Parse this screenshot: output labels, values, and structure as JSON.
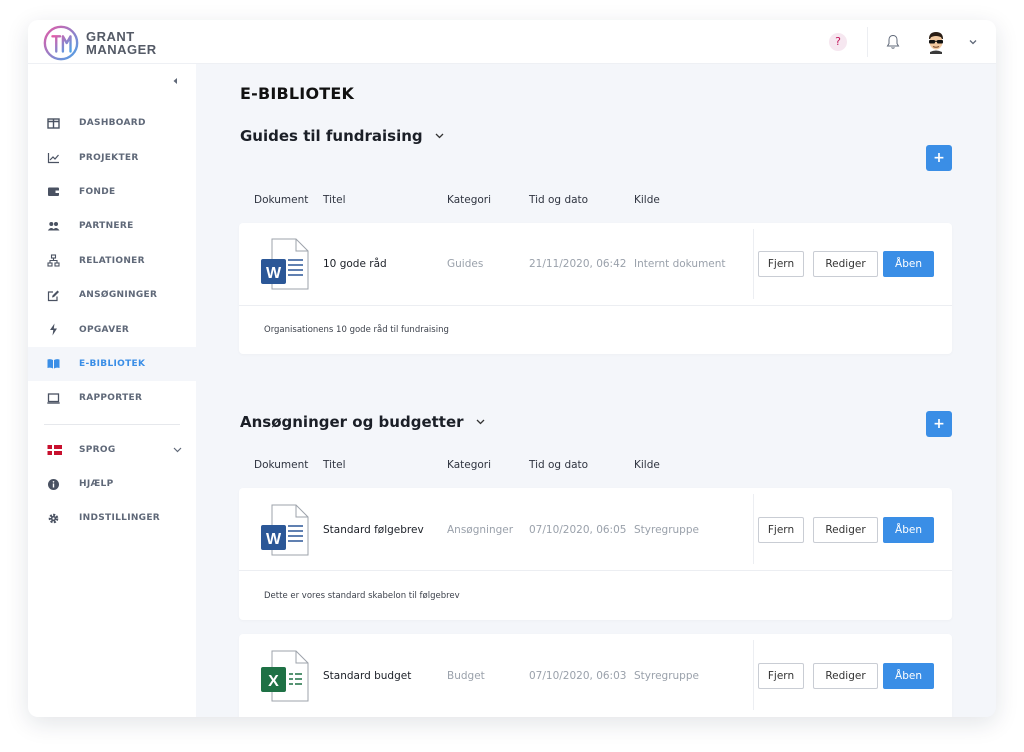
{
  "app": {
    "logo_line1": "GRANT",
    "logo_line2": "MANAGER"
  },
  "topbar": {
    "help": "?"
  },
  "colors": {
    "accent": "#3a8ee6",
    "word": "#2b5797",
    "excel": "#1e7145",
    "danish_red": "#c8102e"
  },
  "sidebar": {
    "items": [
      {
        "label": "DASHBOARD",
        "icon": "dashboard-icon",
        "active": false
      },
      {
        "label": "PROJEKTER",
        "icon": "chart-line-icon",
        "active": false
      },
      {
        "label": "FONDE",
        "icon": "wallet-icon",
        "active": false
      },
      {
        "label": "PARTNERE",
        "icon": "users-icon",
        "active": false
      },
      {
        "label": "RELATIONER",
        "icon": "sitemap-icon",
        "active": false
      },
      {
        "label": "ANSØGNINGER",
        "icon": "edit-icon",
        "active": false
      },
      {
        "label": "OPGAVER",
        "icon": "bolt-icon",
        "active": false
      },
      {
        "label": "E-BIBLIOTEK",
        "icon": "book-icon",
        "active": true
      },
      {
        "label": "RAPPORTER",
        "icon": "laptop-icon",
        "active": false
      }
    ],
    "bottom": [
      {
        "label": "SPROG",
        "icon": "flag-dk-icon"
      },
      {
        "label": "HJÆLP",
        "icon": "info-icon"
      },
      {
        "label": "INDSTILLINGER",
        "icon": "gear-icon"
      }
    ]
  },
  "main": {
    "title": "E-BIBLIOTEK",
    "columns": {
      "doc": "Dokument",
      "title": "Titel",
      "category": "Kategori",
      "datetime": "Tid og dato",
      "source": "Kilde"
    },
    "actions": {
      "remove": "Fjern",
      "edit": "Rediger",
      "open": "Åben",
      "add": "+"
    },
    "sections": [
      {
        "title": "Guides til fundraising",
        "documents": [
          {
            "type": "word",
            "title": "10 gode råd",
            "category": "Guides",
            "datetime": "21/11/2020, 06:42",
            "source": "Internt dokument",
            "description": "Organisationens 10 gode råd til fundraising"
          }
        ]
      },
      {
        "title": "Ansøgninger og budgetter",
        "documents": [
          {
            "type": "word",
            "title": "Standard følgebrev",
            "category": "Ansøgninger",
            "datetime": "07/10/2020, 06:05",
            "source": "Styregruppe",
            "description": "Dette er vores standard skabelon til følgebrev"
          },
          {
            "type": "excel",
            "title": "Standard budget",
            "category": "Budget",
            "datetime": "07/10/2020, 06:03",
            "source": "Styregruppe",
            "description": ""
          }
        ]
      }
    ]
  }
}
